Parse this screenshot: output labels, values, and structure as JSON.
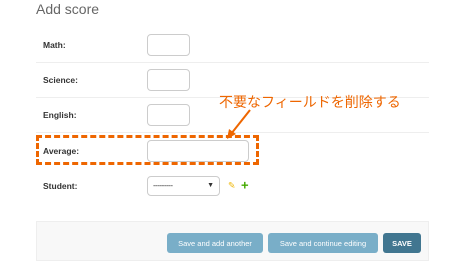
{
  "header": {
    "title": "Add score"
  },
  "fields": {
    "math": {
      "label": "Math:",
      "value": ""
    },
    "science": {
      "label": "Science:",
      "value": ""
    },
    "english": {
      "label": "English:",
      "value": ""
    },
    "average": {
      "label": "Average:",
      "value": ""
    },
    "student": {
      "label": "Student:",
      "selected": "---------"
    }
  },
  "related_widget_icons": {
    "change": "pencil-icon",
    "add": "plus-icon"
  },
  "annotation": {
    "text": "不要なフィールドを削除する",
    "color": "#ee6600"
  },
  "buttons": {
    "add_another": "Save and add another",
    "continue_editing": "Save and continue editing",
    "save": "SAVE"
  },
  "colors": {
    "secondary_button": "#79aec8",
    "primary_button": "#417690",
    "add_icon": "#44aa00",
    "change_icon": "#efb80b"
  }
}
